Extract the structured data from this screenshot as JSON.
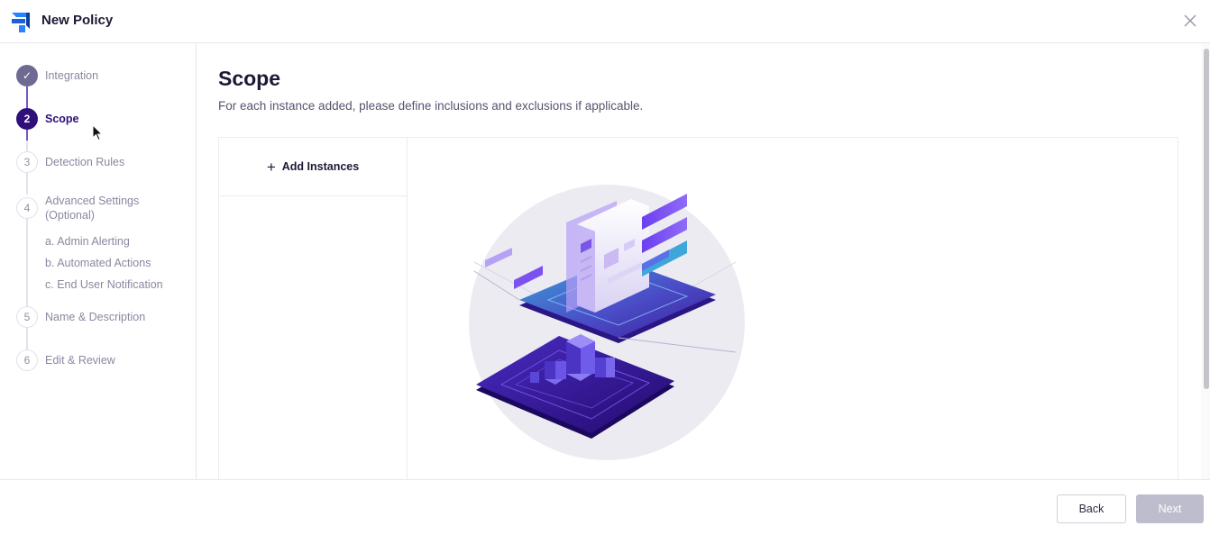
{
  "header": {
    "title": "New Policy"
  },
  "steps": [
    {
      "number": "✓",
      "label": "Integration",
      "state": "done"
    },
    {
      "number": "2",
      "label": "Scope",
      "state": "active"
    },
    {
      "number": "3",
      "label": "Detection Rules",
      "state": "todo"
    },
    {
      "number": "4",
      "label_line1": "Advanced Settings",
      "label_line2": "(Optional)",
      "state": "todo",
      "substeps": [
        "a. Admin Alerting",
        "b. Automated Actions",
        "c. End User Notification"
      ]
    },
    {
      "number": "5",
      "label": "Name & Description",
      "state": "todo"
    },
    {
      "number": "6",
      "label": "Edit & Review",
      "state": "todo"
    }
  ],
  "main": {
    "title": "Scope",
    "description": "For each instance added, please define inclusions and exclusions if applicable.",
    "add_instances_label": "Add Instances"
  },
  "footer": {
    "back_label": "Back",
    "next_label": "Next"
  },
  "colors": {
    "primary": "#2f0f7a",
    "accent": "#7a56c9",
    "disabled": "#bebdcd"
  }
}
